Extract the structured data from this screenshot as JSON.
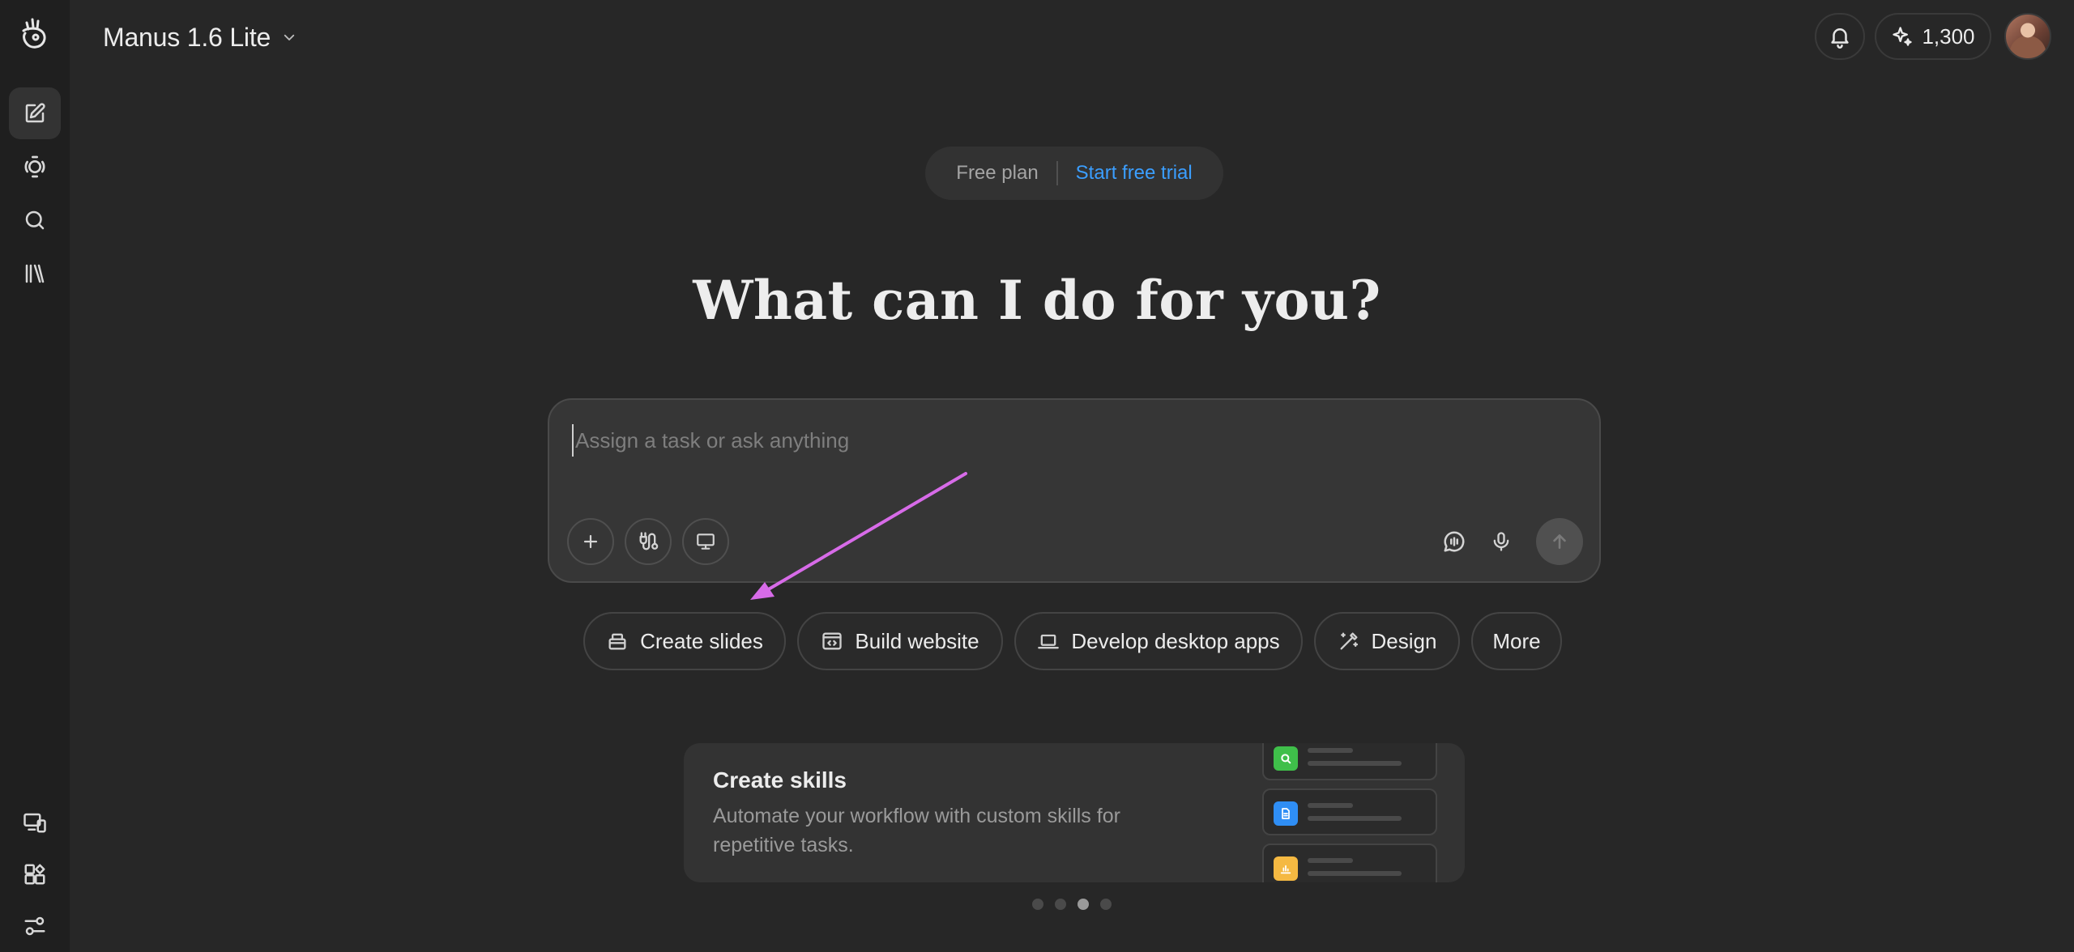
{
  "header": {
    "model_name": "Manus 1.6 Lite",
    "credits": "1,300"
  },
  "plan": {
    "free_label": "Free plan",
    "trial_label": "Start free trial",
    "trial_color": "#3b9eff"
  },
  "main": {
    "heading": "What can I do for you?"
  },
  "composer": {
    "placeholder": "Assign a task or ask anything",
    "value": ""
  },
  "quick_actions": [
    {
      "label": "Create slides",
      "icon": "slides-icon"
    },
    {
      "label": "Build website",
      "icon": "code-window-icon"
    },
    {
      "label": "Develop desktop apps",
      "icon": "laptop-icon"
    },
    {
      "label": "Design",
      "icon": "design-wand-icon"
    },
    {
      "label": "More",
      "icon": ""
    }
  ],
  "promo": {
    "title": "Create skills",
    "description": "Automate your workflow with custom skills for repetitive tasks.",
    "icon_colors": [
      "#3fbf4a",
      "#2f8ef5",
      "#f5b942"
    ]
  },
  "carousel": {
    "count": 4,
    "active_index": 2
  },
  "annotation": {
    "arrow_color": "#d76be8"
  }
}
